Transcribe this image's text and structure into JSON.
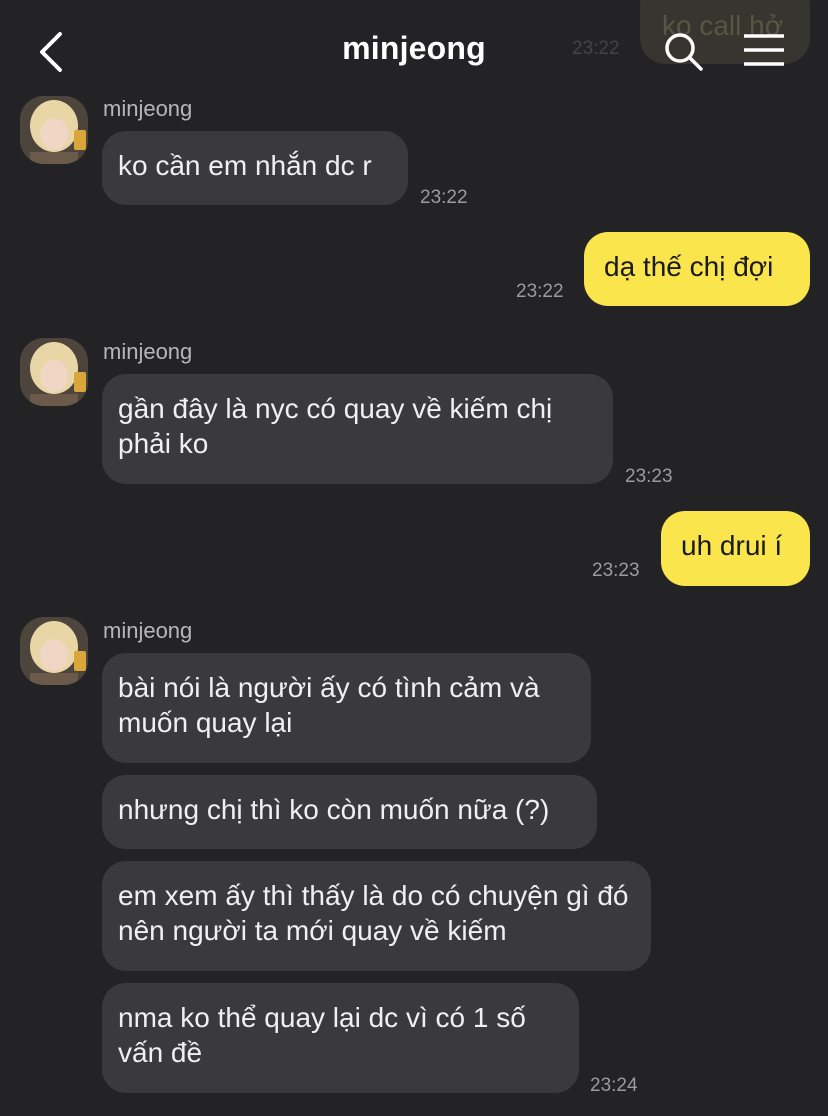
{
  "header": {
    "title": "minjeong",
    "back_icon": "chevron-left-icon",
    "search_icon": "search-icon",
    "menu_icon": "hamburger-menu-icon"
  },
  "previous_message": {
    "text": "ko call hở",
    "time": "23:22"
  },
  "colors": {
    "background": "#232325",
    "incoming_bubble": "#3a3a3d",
    "outgoing_bubble": "#fbe54d"
  },
  "messages": [
    {
      "sender": "minjeong",
      "text": "ko cần em nhắn dc r",
      "time": "23:22"
    },
    {
      "text": "dạ thế chị đợi",
      "time": "23:22"
    },
    {
      "sender": "minjeong",
      "text": "gần đây là nyc có quay về kiếm chị phải ko",
      "time": "23:23"
    },
    {
      "text": "uh drui í",
      "time": "23:23"
    },
    {
      "sender": "minjeong",
      "text": "bài nói là người ấy có tình cảm và muốn quay lại"
    },
    {
      "text": "nhưng chị thì ko còn muốn nữa (?)"
    },
    {
      "text": "em xem ấy thì thấy là do có chuyện gì đó nên người ta mới quay về kiếm"
    },
    {
      "text": "nma ko thể quay lại dc vì có 1 số vấn đề",
      "time": "23:24"
    }
  ]
}
